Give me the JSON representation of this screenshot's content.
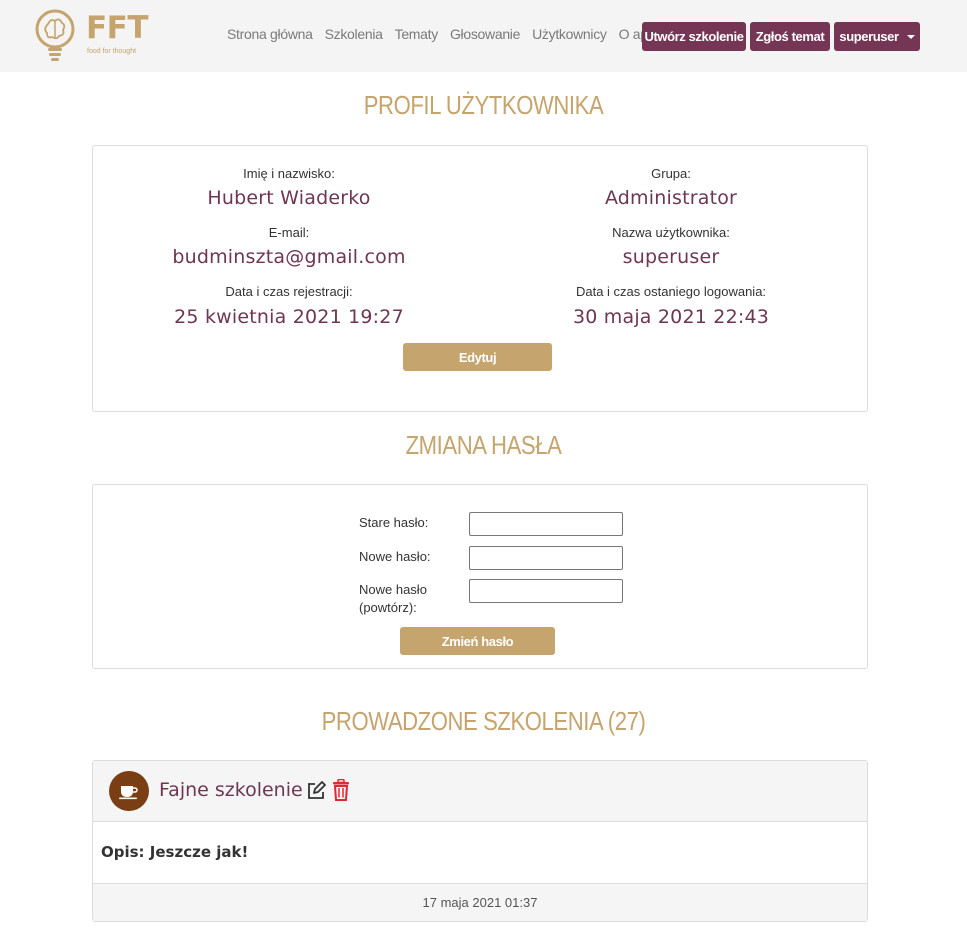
{
  "brand": {
    "name": "FFT",
    "tagline": "food for thought"
  },
  "nav": {
    "links": [
      "Strona główna",
      "Szkolenia",
      "Tematy",
      "Głosowanie",
      "Użytkownicy",
      "O aplikacji"
    ],
    "create_training": "Utwórz szkolenie",
    "report_topic": "Zgłoś temat",
    "user_menu": "superuser"
  },
  "profile": {
    "title": "PROFIL UŻYTKOWNIKA",
    "name_label": "Imię i nazwisko:",
    "name": "Hubert Wiaderko",
    "group_label": "Grupa:",
    "group": "Administrator",
    "email_label": "E-mail:",
    "email": "budminszta@gmail.com",
    "username_label": "Nazwa użytkownika:",
    "username": "superuser",
    "registered_label": "Data i czas rejestracji:",
    "registered": "25 kwietnia 2021 19:27",
    "last_login_label": "Data i czas ostaniego logowania:",
    "last_login": "30 maja 2021 22:43",
    "edit_button": "Edytuj"
  },
  "password": {
    "title": "ZMIANA HASŁA",
    "old_label": "Stare hasło:",
    "new_label": "Nowe hasło:",
    "repeat_label_1": "Nowe hasło",
    "repeat_label_2": "(powtórz):",
    "submit": "Zmień hasło"
  },
  "trainings": {
    "title": "PROWADZONE SZKOLENIA (27)",
    "items": [
      {
        "name": "Fajne szkolenie",
        "description": "Opis: Jeszcze jak!",
        "date": "17 maja 2021 01:37"
      }
    ]
  },
  "colors": {
    "accent": "#753656",
    "gold": "#c5a46d",
    "value": "#6e3651",
    "delete": "#e0282e"
  },
  "icons": {
    "logo": "lightbulb-brain-icon",
    "avatar": "coffee-cup-icon",
    "edit": "edit-icon",
    "delete": "trash-icon"
  }
}
